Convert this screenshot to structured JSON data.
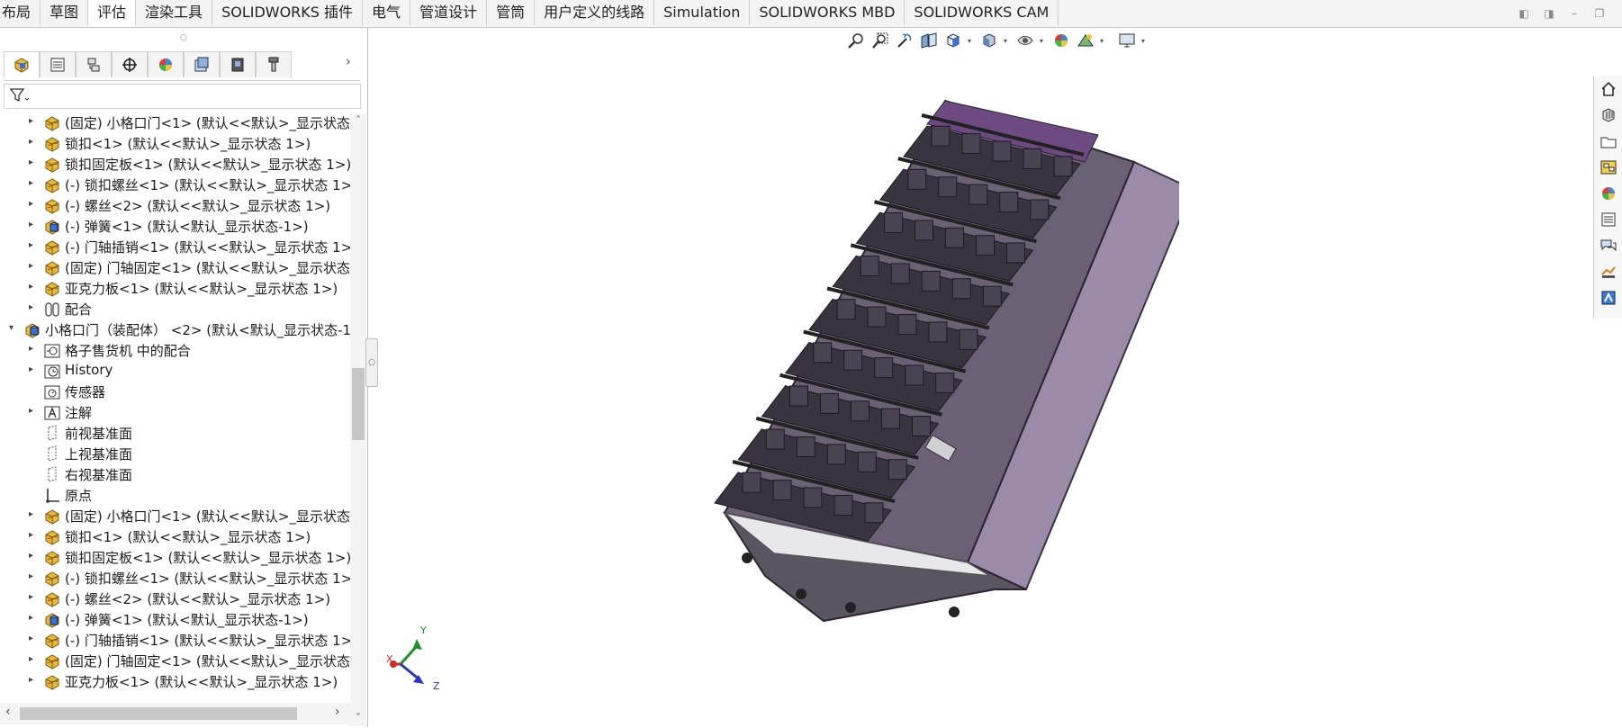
{
  "tabs": [
    "布局",
    "草图",
    "评估",
    "渲染工具",
    "SOLIDWORKS 插件",
    "电气",
    "管道设计",
    "管筒",
    "用户定义的线路",
    "Simulation",
    "SOLIDWORKS MBD",
    "SOLIDWORKS CAM"
  ],
  "active_tab_index": 2,
  "window_controls": [
    "restore-left-icon",
    "restore-right-icon",
    "minimize-icon",
    "restore-icon"
  ],
  "panel_tabs": [
    "feature-manager-icon",
    "property-manager-icon",
    "configuration-manager-icon",
    "dimxpert-icon",
    "display-manager-icon",
    "cam-feature-icon",
    "cam-operation-icon",
    "cam-tool-icon"
  ],
  "tree": [
    {
      "level": 1,
      "expand": true,
      "icon": "part-fixed",
      "label": "(固定) 小格口门<1> (默认<<默认>_显示状态 1"
    },
    {
      "level": 1,
      "expand": true,
      "icon": "part",
      "label": "锁扣<1> (默认<<默认>_显示状态 1>)"
    },
    {
      "level": 1,
      "expand": true,
      "icon": "part",
      "label": "锁扣固定板<1> (默认<<默认>_显示状态 1>)"
    },
    {
      "level": 1,
      "expand": true,
      "icon": "part",
      "label": "(-) 锁扣螺丝<1> (默认<<默认>_显示状态 1>)"
    },
    {
      "level": 1,
      "expand": true,
      "icon": "part",
      "label": "(-) 螺丝<2> (默认<<默认>_显示状态 1>)"
    },
    {
      "level": 1,
      "expand": true,
      "icon": "assembly",
      "label": "(-) 弹簧<1> (默认<默认_显示状态-1>)"
    },
    {
      "level": 1,
      "expand": true,
      "icon": "part",
      "label": "(-) 门轴插销<1> (默认<<默认>_显示状态 1>)"
    },
    {
      "level": 1,
      "expand": true,
      "icon": "part",
      "label": "(固定) 门轴固定<1> (默认<<默认>_显示状态 1"
    },
    {
      "level": 1,
      "expand": true,
      "icon": "part",
      "label": "亚克力板<1> (默认<<默认>_显示状态 1>)"
    },
    {
      "level": 1,
      "expand": true,
      "icon": "mates",
      "label": "配合"
    },
    {
      "level": 0,
      "expand": "open",
      "icon": "assembly",
      "label": "小格口门（装配体） <2> (默认<默认_显示状态-1>"
    },
    {
      "level": 1,
      "expand": true,
      "icon": "mates-in",
      "label": "格子售货机 中的配合"
    },
    {
      "level": 1,
      "expand": true,
      "icon": "history",
      "label": "History"
    },
    {
      "level": 1,
      "expand": false,
      "icon": "sensor",
      "label": "传感器"
    },
    {
      "level": 1,
      "expand": true,
      "icon": "annotation",
      "label": "注解"
    },
    {
      "level": 1,
      "expand": false,
      "icon": "plane",
      "label": "前视基准面"
    },
    {
      "level": 1,
      "expand": false,
      "icon": "plane",
      "label": "上视基准面"
    },
    {
      "level": 1,
      "expand": false,
      "icon": "plane",
      "label": "右视基准面"
    },
    {
      "level": 1,
      "expand": false,
      "icon": "origin",
      "label": "原点"
    },
    {
      "level": 1,
      "expand": true,
      "icon": "part-fixed",
      "label": "(固定) 小格口门<1> (默认<<默认>_显示状态 1"
    },
    {
      "level": 1,
      "expand": true,
      "icon": "part",
      "label": "锁扣<1> (默认<<默认>_显示状态 1>)"
    },
    {
      "level": 1,
      "expand": true,
      "icon": "part",
      "label": "锁扣固定板<1> (默认<<默认>_显示状态 1>)"
    },
    {
      "level": 1,
      "expand": true,
      "icon": "part",
      "label": "(-) 锁扣螺丝<1> (默认<<默认>_显示状态 1>)"
    },
    {
      "level": 1,
      "expand": true,
      "icon": "part",
      "label": "(-) 螺丝<2> (默认<<默认>_显示状态 1>)"
    },
    {
      "level": 1,
      "expand": true,
      "icon": "assembly",
      "label": "(-) 弹簧<1> (默认<默认_显示状态-1>)"
    },
    {
      "level": 1,
      "expand": true,
      "icon": "part",
      "label": "(-) 门轴插销<1> (默认<<默认>_显示状态 1>)"
    },
    {
      "level": 1,
      "expand": true,
      "icon": "part",
      "label": "(固定) 门轴固定<1> (默认<<默认>_显示状态 1"
    },
    {
      "level": 1,
      "expand": true,
      "icon": "part",
      "label": "亚克力板<1> (默认<<默认>_显示状态 1>)"
    }
  ],
  "view_toolbar": [
    "zoom-to-fit-icon",
    "zoom-to-area-icon",
    "previous-view-icon",
    "section-view-icon",
    "view-orientation-icon",
    "display-style-icon",
    "hide-show-icon",
    "edit-appearance-icon",
    "apply-scene-icon",
    "view-settings-icon"
  ],
  "task_pane": [
    "home-icon",
    "design-library-icon",
    "file-explorer-icon",
    "view-palette-icon",
    "appearances-icon",
    "custom-properties-icon",
    "forum-icon",
    "solidworks-resources-icon",
    "cam-icon"
  ],
  "triad": {
    "x": "X",
    "y": "Y",
    "z": "Z"
  },
  "colors": {
    "model_purple": "#9b8aa8",
    "model_dark": "#3a3440",
    "part_yellow": "#e8b83a",
    "triad_x": "#d12a2a",
    "triad_y": "#1e8f2a",
    "triad_z": "#2a36c8"
  }
}
